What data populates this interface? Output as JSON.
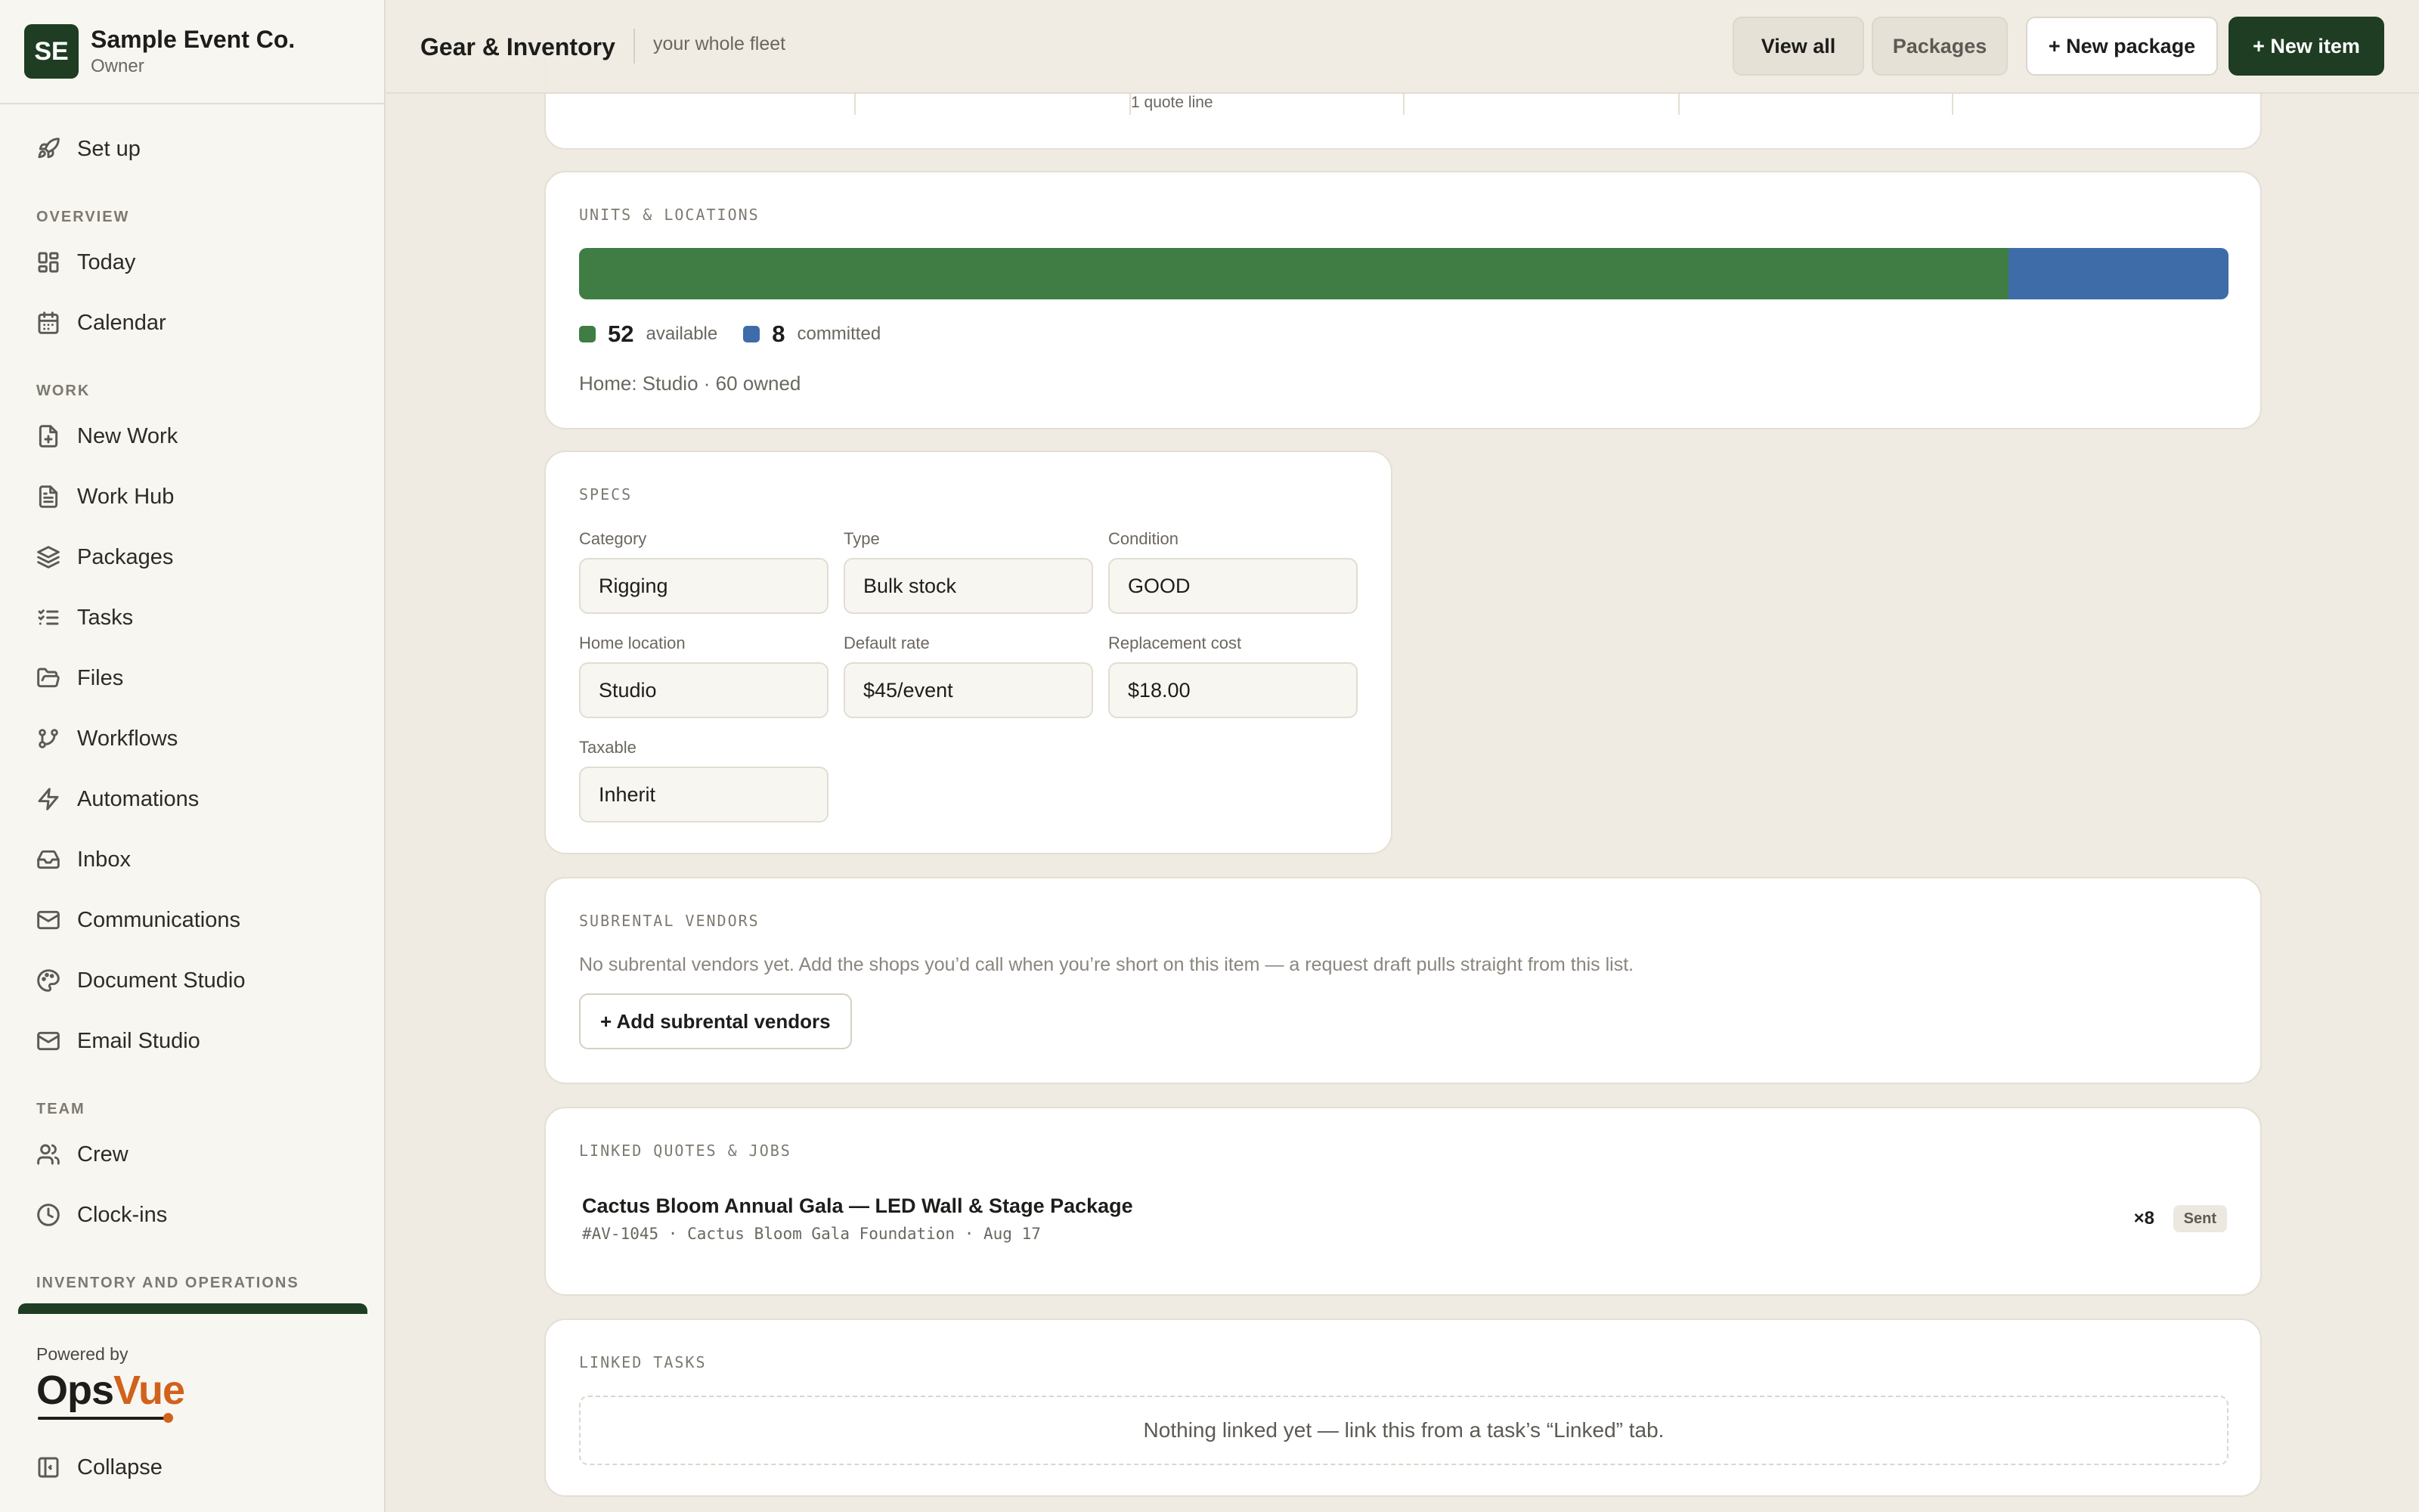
{
  "org": {
    "initials": "SE",
    "name": "Sample Event Co.",
    "role": "Owner"
  },
  "nav": {
    "setup": "Set up",
    "overview_label": "OVERVIEW",
    "today": "Today",
    "calendar": "Calendar",
    "work_label": "WORK",
    "new_work": "New Work",
    "work_hub": "Work Hub",
    "packages": "Packages",
    "tasks": "Tasks",
    "files": "Files",
    "workflows": "Workflows",
    "automations": "Automations",
    "inbox": "Inbox",
    "communications": "Communications",
    "document_studio": "Document Studio",
    "email_studio": "Email Studio",
    "team_label": "TEAM",
    "crew": "Crew",
    "clock_ins": "Clock-ins",
    "inventory_label": "INVENTORY AND OPERATIONS"
  },
  "footer": {
    "powered_by": "Powered by",
    "brand_a": "Ops",
    "brand_b": "Vue",
    "collapse": "Collapse"
  },
  "topbar": {
    "title": "Gear & Inventory",
    "subtitle": "your whole fleet",
    "view_all": "View all",
    "packages": "Packages",
    "new_package": "+ New package",
    "new_item": "+ New item"
  },
  "stats": {
    "quote_line": "1 quote line"
  },
  "units": {
    "label": "UNITS & LOCATIONS",
    "available": 52,
    "available_label": "available",
    "available_color": "#3f7d44",
    "committed": 8,
    "committed_label": "committed",
    "committed_color": "#3e6ca8",
    "home": "Home: Studio · 60 owned"
  },
  "specs": {
    "label": "SPECS",
    "fields": [
      {
        "label": "Category",
        "value": "Rigging"
      },
      {
        "label": "Type",
        "value": "Bulk stock"
      },
      {
        "label": "Condition",
        "value": "GOOD"
      },
      {
        "label": "Home location",
        "value": "Studio"
      },
      {
        "label": "Default rate",
        "value": "$45/event"
      },
      {
        "label": "Replacement cost",
        "value": "$18.00"
      },
      {
        "label": "Taxable",
        "value": "Inherit"
      }
    ]
  },
  "vendors": {
    "label": "SUBRENTAL VENDORS",
    "empty": "No subrental vendors yet. Add the shops you’d call when you’re short on this item — a request draft pulls straight from this list.",
    "add_button": "+ Add subrental vendors"
  },
  "linked_quotes": {
    "label": "LINKED QUOTES & JOBS",
    "items": [
      {
        "title": "Cactus Bloom Annual Gala — LED Wall & Stage Package",
        "meta": "#AV-1045 · Cactus Bloom Gala Foundation · Aug 17",
        "qty": "×8",
        "status": "Sent"
      }
    ]
  },
  "linked_tasks": {
    "label": "LINKED TASKS",
    "empty": "Nothing linked yet — link this from a task’s “Linked” tab."
  }
}
